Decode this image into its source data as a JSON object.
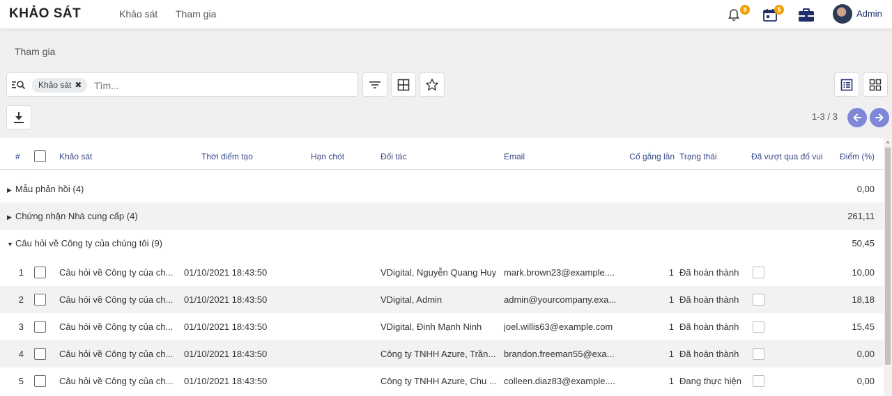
{
  "navbar": {
    "brand": "KHẢO SÁT",
    "menu": [
      "Khảo sát",
      "Tham gia"
    ],
    "activity_count": "8",
    "calendar_count": "5",
    "user_name": "Admin",
    "icons": [
      "bell-icon",
      "calendar-icon",
      "briefcase-icon"
    ]
  },
  "control_panel": {
    "breadcrumb": "Tham gia",
    "search": {
      "facet_label": "Khảo sát",
      "placeholder": "Tìm..."
    },
    "pager": "1-3 / 3",
    "accent_color": "#7f88d8"
  },
  "table": {
    "columns": [
      "#",
      "Khảo sát",
      "Thời điểm tạo",
      "Hạn chót",
      "Đối tác",
      "Email",
      "Cố gắng lần",
      "Trạng thái",
      "Đã vượt qua đố vui",
      "Điểm (%)"
    ],
    "groups": [
      {
        "label": "Mẫu phản hồi (4)",
        "score": "0,00",
        "expanded": false
      },
      {
        "label": "Chứng nhận Nhà cung cấp (4)",
        "score": "261,11",
        "expanded": false
      },
      {
        "label": "Câu hỏi về Công ty của chúng tôi (9)",
        "score": "50,45",
        "expanded": true
      }
    ],
    "rows": [
      {
        "index": "1",
        "survey": "Câu hỏi về Công ty của ch...",
        "created": "01/10/2021 18:43:50",
        "deadline": "",
        "partner": "VDigital, Nguyễn Quang Huy",
        "email": "mark.brown23@example....",
        "attempt": "1",
        "status": "Đã hoàn thành",
        "score": "10,00"
      },
      {
        "index": "2",
        "survey": "Câu hỏi về Công ty của ch...",
        "created": "01/10/2021 18:43:50",
        "deadline": "",
        "partner": "VDigital, Admin",
        "email": "admin@yourcompany.exa...",
        "attempt": "1",
        "status": "Đã hoàn thành",
        "score": "18,18"
      },
      {
        "index": "3",
        "survey": "Câu hỏi về Công ty của ch...",
        "created": "01/10/2021 18:43:50",
        "deadline": "",
        "partner": "VDigital, Đinh Mạnh Ninh",
        "email": "joel.willis63@example.com",
        "attempt": "1",
        "status": "Đã hoàn thành",
        "score": "15,45"
      },
      {
        "index": "4",
        "survey": "Câu hỏi về Công ty của ch...",
        "created": "01/10/2021 18:43:50",
        "deadline": "",
        "partner": "Công ty TNHH Azure, Trần...",
        "email": "brandon.freeman55@exa...",
        "attempt": "1",
        "status": "Đã hoàn thành",
        "score": "0,00"
      },
      {
        "index": "5",
        "survey": "Câu hỏi về Công ty của ch...",
        "created": "01/10/2021 18:43:50",
        "deadline": "",
        "partner": "Công ty TNHH Azure, Chu ...",
        "email": "colleen.diaz83@example....",
        "attempt": "1",
        "status": "Đang thực hiện",
        "score": "0,00"
      }
    ]
  }
}
